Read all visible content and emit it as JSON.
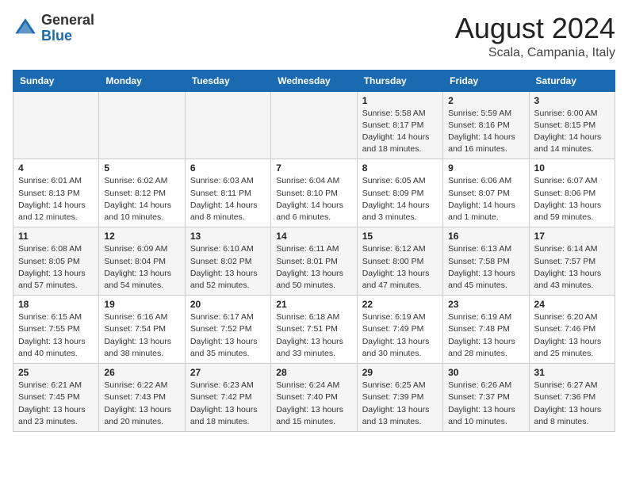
{
  "header": {
    "logo_general": "General",
    "logo_blue": "Blue",
    "month": "August 2024",
    "location": "Scala, Campania, Italy"
  },
  "weekdays": [
    "Sunday",
    "Monday",
    "Tuesday",
    "Wednesday",
    "Thursday",
    "Friday",
    "Saturday"
  ],
  "weeks": [
    [
      {
        "day": "",
        "info": ""
      },
      {
        "day": "",
        "info": ""
      },
      {
        "day": "",
        "info": ""
      },
      {
        "day": "",
        "info": ""
      },
      {
        "day": "1",
        "info": "Sunrise: 5:58 AM\nSunset: 8:17 PM\nDaylight: 14 hours\nand 18 minutes."
      },
      {
        "day": "2",
        "info": "Sunrise: 5:59 AM\nSunset: 8:16 PM\nDaylight: 14 hours\nand 16 minutes."
      },
      {
        "day": "3",
        "info": "Sunrise: 6:00 AM\nSunset: 8:15 PM\nDaylight: 14 hours\nand 14 minutes."
      }
    ],
    [
      {
        "day": "4",
        "info": "Sunrise: 6:01 AM\nSunset: 8:13 PM\nDaylight: 14 hours\nand 12 minutes."
      },
      {
        "day": "5",
        "info": "Sunrise: 6:02 AM\nSunset: 8:12 PM\nDaylight: 14 hours\nand 10 minutes."
      },
      {
        "day": "6",
        "info": "Sunrise: 6:03 AM\nSunset: 8:11 PM\nDaylight: 14 hours\nand 8 minutes."
      },
      {
        "day": "7",
        "info": "Sunrise: 6:04 AM\nSunset: 8:10 PM\nDaylight: 14 hours\nand 6 minutes."
      },
      {
        "day": "8",
        "info": "Sunrise: 6:05 AM\nSunset: 8:09 PM\nDaylight: 14 hours\nand 3 minutes."
      },
      {
        "day": "9",
        "info": "Sunrise: 6:06 AM\nSunset: 8:07 PM\nDaylight: 14 hours\nand 1 minute."
      },
      {
        "day": "10",
        "info": "Sunrise: 6:07 AM\nSunset: 8:06 PM\nDaylight: 13 hours\nand 59 minutes."
      }
    ],
    [
      {
        "day": "11",
        "info": "Sunrise: 6:08 AM\nSunset: 8:05 PM\nDaylight: 13 hours\nand 57 minutes."
      },
      {
        "day": "12",
        "info": "Sunrise: 6:09 AM\nSunset: 8:04 PM\nDaylight: 13 hours\nand 54 minutes."
      },
      {
        "day": "13",
        "info": "Sunrise: 6:10 AM\nSunset: 8:02 PM\nDaylight: 13 hours\nand 52 minutes."
      },
      {
        "day": "14",
        "info": "Sunrise: 6:11 AM\nSunset: 8:01 PM\nDaylight: 13 hours\nand 50 minutes."
      },
      {
        "day": "15",
        "info": "Sunrise: 6:12 AM\nSunset: 8:00 PM\nDaylight: 13 hours\nand 47 minutes."
      },
      {
        "day": "16",
        "info": "Sunrise: 6:13 AM\nSunset: 7:58 PM\nDaylight: 13 hours\nand 45 minutes."
      },
      {
        "day": "17",
        "info": "Sunrise: 6:14 AM\nSunset: 7:57 PM\nDaylight: 13 hours\nand 43 minutes."
      }
    ],
    [
      {
        "day": "18",
        "info": "Sunrise: 6:15 AM\nSunset: 7:55 PM\nDaylight: 13 hours\nand 40 minutes."
      },
      {
        "day": "19",
        "info": "Sunrise: 6:16 AM\nSunset: 7:54 PM\nDaylight: 13 hours\nand 38 minutes."
      },
      {
        "day": "20",
        "info": "Sunrise: 6:17 AM\nSunset: 7:52 PM\nDaylight: 13 hours\nand 35 minutes."
      },
      {
        "day": "21",
        "info": "Sunrise: 6:18 AM\nSunset: 7:51 PM\nDaylight: 13 hours\nand 33 minutes."
      },
      {
        "day": "22",
        "info": "Sunrise: 6:19 AM\nSunset: 7:49 PM\nDaylight: 13 hours\nand 30 minutes."
      },
      {
        "day": "23",
        "info": "Sunrise: 6:19 AM\nSunset: 7:48 PM\nDaylight: 13 hours\nand 28 minutes."
      },
      {
        "day": "24",
        "info": "Sunrise: 6:20 AM\nSunset: 7:46 PM\nDaylight: 13 hours\nand 25 minutes."
      }
    ],
    [
      {
        "day": "25",
        "info": "Sunrise: 6:21 AM\nSunset: 7:45 PM\nDaylight: 13 hours\nand 23 minutes."
      },
      {
        "day": "26",
        "info": "Sunrise: 6:22 AM\nSunset: 7:43 PM\nDaylight: 13 hours\nand 20 minutes."
      },
      {
        "day": "27",
        "info": "Sunrise: 6:23 AM\nSunset: 7:42 PM\nDaylight: 13 hours\nand 18 minutes."
      },
      {
        "day": "28",
        "info": "Sunrise: 6:24 AM\nSunset: 7:40 PM\nDaylight: 13 hours\nand 15 minutes."
      },
      {
        "day": "29",
        "info": "Sunrise: 6:25 AM\nSunset: 7:39 PM\nDaylight: 13 hours\nand 13 minutes."
      },
      {
        "day": "30",
        "info": "Sunrise: 6:26 AM\nSunset: 7:37 PM\nDaylight: 13 hours\nand 10 minutes."
      },
      {
        "day": "31",
        "info": "Sunrise: 6:27 AM\nSunset: 7:36 PM\nDaylight: 13 hours\nand 8 minutes."
      }
    ]
  ]
}
